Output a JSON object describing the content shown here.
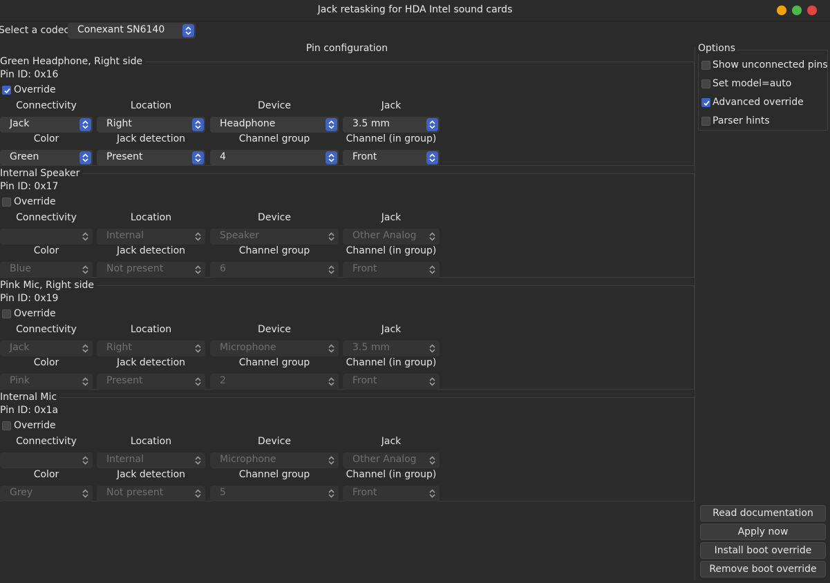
{
  "window": {
    "title": "Jack retasking for HDA Intel sound cards",
    "controls": [
      "minimize",
      "maximize",
      "close"
    ],
    "control_colors": [
      "#f0a30a",
      "#4ab947",
      "#e0443e"
    ]
  },
  "codec": {
    "label": "Select a codec:",
    "value": "Conexant SN6140"
  },
  "pin_config_title": "Pin configuration",
  "field_labels": {
    "connectivity": "Connectivity",
    "location": "Location",
    "device": "Device",
    "jack": "Jack",
    "color": "Color",
    "jack_detection": "Jack detection",
    "channel_group": "Channel group",
    "channel_in_group": "Channel (in group)"
  },
  "override_label": "Override",
  "pins": [
    {
      "title": "Green Headphone, Right side",
      "pin_id": "Pin ID: 0x16",
      "override": true,
      "connectivity": "Jack",
      "location": "Right",
      "device": "Headphone",
      "jack": "3.5 mm",
      "color": "Green",
      "jack_detection": "Present",
      "channel_group": "4",
      "channel_in_group": "Front"
    },
    {
      "title": "Internal Speaker",
      "pin_id": "Pin ID: 0x17",
      "override": false,
      "connectivity": "",
      "location": "Internal",
      "device": "Speaker",
      "jack": "Other Analog",
      "color": "Blue",
      "jack_detection": "Not present",
      "channel_group": "6",
      "channel_in_group": "Front"
    },
    {
      "title": "Pink Mic, Right side",
      "pin_id": "Pin ID: 0x19",
      "override": false,
      "connectivity": "Jack",
      "location": "Right",
      "device": "Microphone",
      "jack": "3.5 mm",
      "color": "Pink",
      "jack_detection": "Present",
      "channel_group": "2",
      "channel_in_group": "Front"
    },
    {
      "title": "Internal Mic",
      "pin_id": "Pin ID: 0x1a",
      "override": false,
      "connectivity": "",
      "location": "Internal",
      "device": "Microphone",
      "jack": "Other Analog",
      "color": "Grey",
      "jack_detection": "Not present",
      "channel_group": "5",
      "channel_in_group": "Front"
    }
  ],
  "options": {
    "title": "Options",
    "items": [
      {
        "label": "Show unconnected pins",
        "checked": false
      },
      {
        "label": "Set model=auto",
        "checked": false
      },
      {
        "label": "Advanced override",
        "checked": true
      },
      {
        "label": "Parser hints",
        "checked": false
      }
    ]
  },
  "buttons": {
    "read_documentation": "Read documentation",
    "apply_now": "Apply now",
    "install_boot_override": "Install boot override",
    "remove_boot_override": "Remove boot override"
  },
  "colors": {
    "accent": "#3d63c9",
    "background": "#2b2b2b"
  }
}
